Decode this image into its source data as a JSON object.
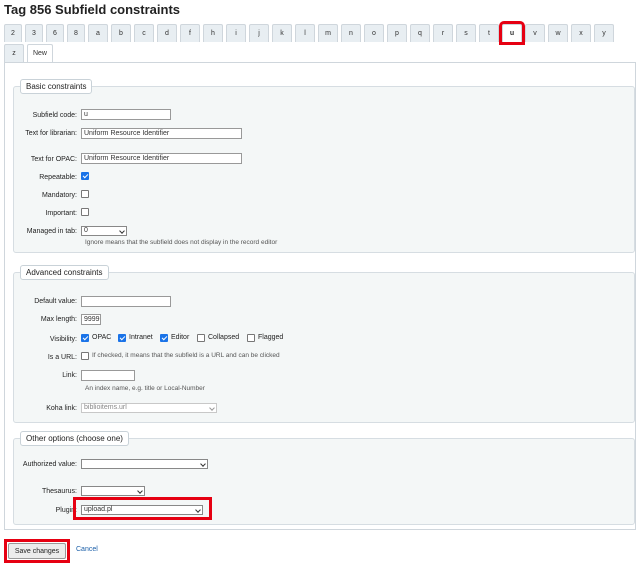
{
  "page": {
    "title": "Tag 856 Subfield constraints"
  },
  "tabs": [
    "2",
    "3",
    "6",
    "8",
    "a",
    "b",
    "c",
    "d",
    "f",
    "h",
    "i",
    "j",
    "k",
    "l",
    "m",
    "n",
    "o",
    "p",
    "q",
    "r",
    "s",
    "t",
    "u",
    "v",
    "w",
    "x",
    "y",
    "z",
    "New"
  ],
  "active_tab": "u",
  "basic": {
    "legend": "Basic constraints",
    "subfield_code_label": "Subfield code:",
    "subfield_code_value": "u",
    "text_librarian_label": "Text for librarian:",
    "text_librarian_value": "Uniform Resource Identifier",
    "text_opac_label": "Text for OPAC:",
    "text_opac_value": "Uniform Resource Identifier",
    "repeatable_label": "Repeatable:",
    "mandatory_label": "Mandatory:",
    "important_label": "Important:",
    "managed_label": "Managed in tab:",
    "managed_value": "0",
    "managed_hint": "Ignore means that the subfield does not display in the record editor"
  },
  "advanced": {
    "legend": "Advanced constraints",
    "default_label": "Default value:",
    "default_value": "",
    "maxlen_label": "Max length:",
    "maxlen_value": "9999",
    "visibility_label": "Visibility:",
    "vis_opac": "OPAC",
    "vis_intranet": "Intranet",
    "vis_editor": "Editor",
    "vis_collapsed": "Collapsed",
    "vis_flagged": "Flagged",
    "url_label": "Is a URL:",
    "url_hint": "If checked, it means that the subfield is a URL and can be clicked",
    "link_label": "Link:",
    "link_hint": "An index name, e.g. title or Local-Number",
    "koha_label": "Koha link:",
    "koha_value": "biblioitems.url"
  },
  "other": {
    "legend": "Other options (choose one)",
    "authorized_label": "Authorized value:",
    "thesaurus_label": "Thesaurus:",
    "plugin_label": "Plugin:",
    "plugin_value": "upload.pl"
  },
  "actions": {
    "save": "Save changes",
    "cancel": "Cancel"
  },
  "colors": {
    "highlight": "#e60012",
    "checkbox": "#1a73e8",
    "link": "#1a5ea8"
  }
}
